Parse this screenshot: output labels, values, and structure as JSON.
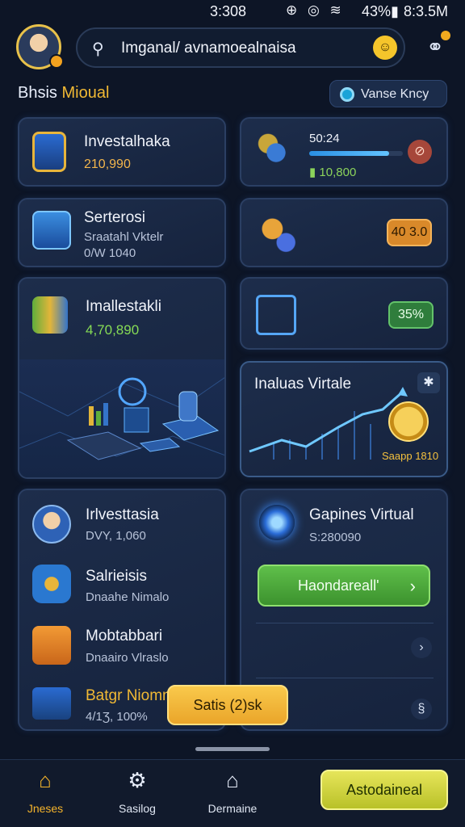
{
  "status_bar": {
    "time": "3:308",
    "icons": "⊕ ◎ ≋",
    "battery": "43%▮",
    "clock_right": "8:3.5M"
  },
  "header": {
    "search_value": "Imganal/ avnamoealnaisa",
    "search_icon": "filter-icon",
    "emoji_icon": "smiley-icon",
    "link_icon": "link-icon"
  },
  "section": {
    "title_part1": "Bhsis ",
    "title_part2": "Mioual",
    "pill_label": "Vanse Kncy"
  },
  "cards": {
    "investalhaka": {
      "title": "Investalhaka",
      "value": "210,990"
    },
    "stats": {
      "title": "50:24",
      "value": "▮ 10,800",
      "progress": 0.85,
      "action": "⊘"
    },
    "serterosi": {
      "title": "Serterosi",
      "sub1": "Sraatahl Vktelr",
      "sub2": "0/W 1040"
    },
    "gears": {
      "badge": "40 3.0"
    },
    "imallestakli": {
      "title": "Imallestakli",
      "value": "4,70,890"
    },
    "check": {
      "badge": "35%"
    },
    "inaluas": {
      "title": "Inaluas Virtale",
      "close": "✱",
      "caption": "Saapp 1810"
    }
  },
  "list": [
    {
      "title": "Irlvesttasia",
      "sub": "DVY, 1,060"
    },
    {
      "title": "Salrieisis",
      "sub": "Dnaahe Nimalo"
    },
    {
      "title": "Mobtabbari",
      "sub": "Dnaairo Vlraslo"
    },
    {
      "title": "Batgr Niomnn",
      "sub": "4/1Ʒ, 100%"
    }
  ],
  "virtual": {
    "title": "Gapines Virtual",
    "sub": "S:280090",
    "button": "Haondareall'",
    "chev1": "›",
    "chev2": "§"
  },
  "float_button": "Satis (2)sk",
  "nav": {
    "items": [
      {
        "label": "Jneses",
        "icon": "home-icon"
      },
      {
        "label": "Sasilog",
        "icon": "settings-icon"
      },
      {
        "label": "Dermaine",
        "icon": "house-outline-icon"
      }
    ],
    "cta": "Astodaineal"
  }
}
